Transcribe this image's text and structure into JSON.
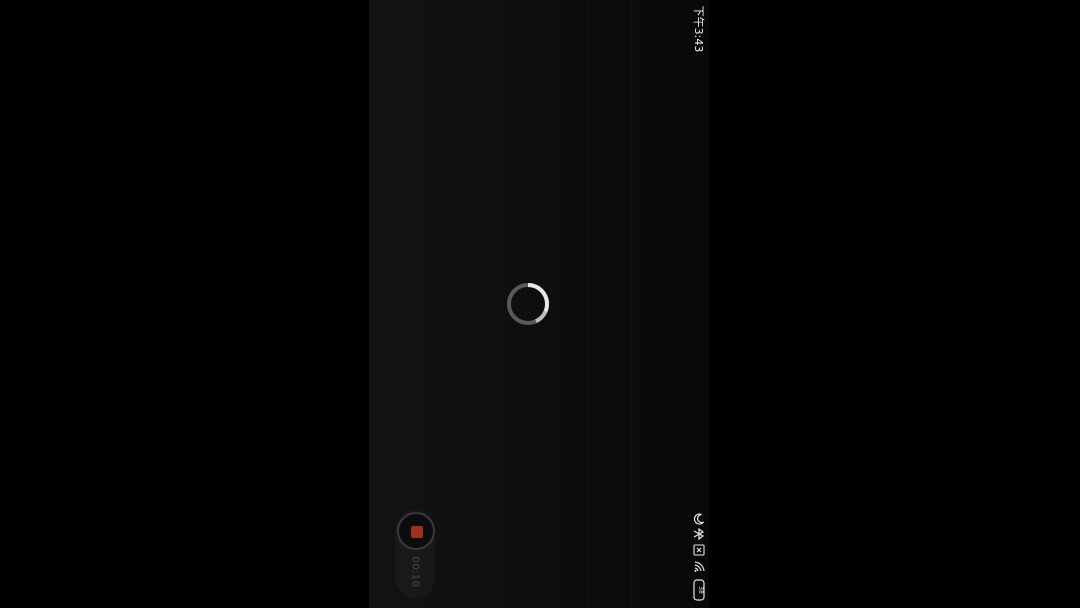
{
  "status_bar": {
    "time": "下午3:43",
    "icons": [
      "moon-icon",
      "bluetooth-icon",
      "sim-off-icon",
      "wifi-icon",
      "battery-icon"
    ],
    "battery_level": "38"
  },
  "loading": {
    "icon": "loading-spinner-icon"
  },
  "recorder": {
    "elapsed": "00:10",
    "stop_color": "#a0301c",
    "icon": "stop-recording-icon"
  },
  "colors": {
    "background": "#000000",
    "screen": "#0e0f11",
    "spinner_track": "#5a5a5a",
    "spinner_arc": "#e8e8e8"
  }
}
